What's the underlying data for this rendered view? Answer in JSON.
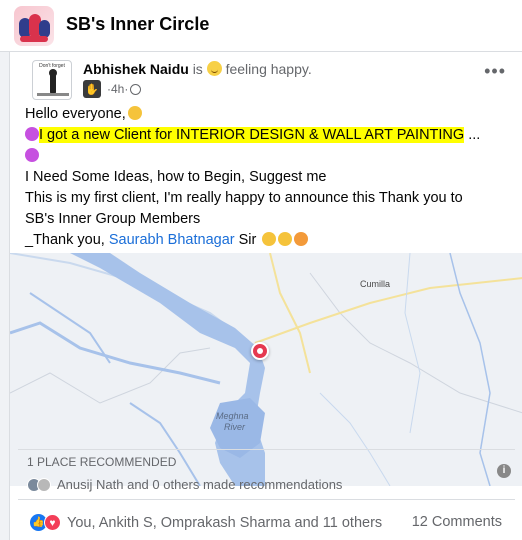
{
  "group": {
    "title": "SB's Inner Circle"
  },
  "post": {
    "author": "Abhishek Naidu",
    "status_prefix": "is",
    "status_text": "feeling happy.",
    "time": "4h",
    "avatar_text": "Don't forget",
    "lines": {
      "l1": "Hello everyone,",
      "l2": "I got a new Client for INTERIOR DESIGN & WALL ART PAINTING",
      "l2_suffix": " ...",
      "l4": "I Need Some Ideas, how to Begin, Suggest me",
      "l5": " This is my first client, I'm really happy to announce this Thank you to",
      "l6": "SB's Inner Group Members",
      "l7_prefix": "_Thank you, ",
      "l7_link": "Saurabh Bhatnagar",
      "l7_suffix": " Sir "
    }
  },
  "map": {
    "city": "Cumilla",
    "river_line1": "Meghna",
    "river_line2": "River",
    "info_icon": "i"
  },
  "recommendations": {
    "count_text": "1 PLACE RECOMMENDED",
    "by_text": "Anusij Nath and 0 others made recommendations"
  },
  "footer": {
    "reactions_text": "You, Ankith S, Omprakash Sharma and 11 others",
    "comments_text": "12 Comments"
  },
  "colors": {
    "link": "#1a6ed8",
    "highlight": "#ffff00",
    "like": "#1877f2",
    "love": "#f33e58",
    "pin": "#e53950"
  }
}
